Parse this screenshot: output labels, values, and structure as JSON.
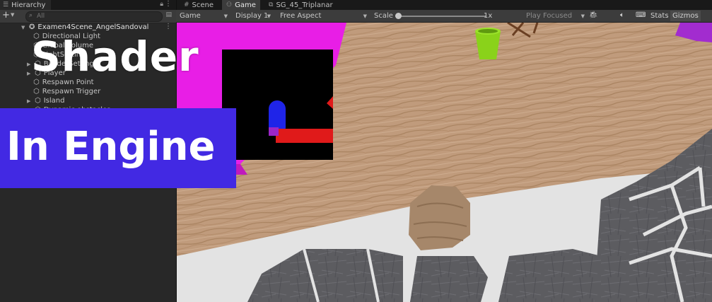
{
  "hierarchy": {
    "tab_label": "Hierarchy",
    "search_placeholder": "All",
    "add_label": "+",
    "items": [
      {
        "label": "Examen4Scene_AngelSandoval"
      },
      {
        "label": "Directional Light"
      },
      {
        "label": "Global Volume"
      },
      {
        "label": "LightSetting"
      },
      {
        "label": "BuilderSetting"
      },
      {
        "label": "Player"
      },
      {
        "label": "Respawn Point"
      },
      {
        "label": "Respawn Trigger"
      },
      {
        "label": "Island"
      },
      {
        "label": "Dynamic obstacles"
      }
    ]
  },
  "view": {
    "tabs": [
      {
        "label": "Scene",
        "icon": "grid-icon"
      },
      {
        "label": "Game",
        "icon": "gamepad-icon"
      },
      {
        "label": "SG_45_Triplanar",
        "icon": "shader-graph-icon"
      }
    ],
    "toolbar": {
      "display_mode": "Game",
      "display": "Display 1",
      "aspect": "Free Aspect",
      "scale_label": "Scale",
      "scale_value": "1x",
      "play_mode": "Play Focused",
      "stats_label": "Stats",
      "gizmos_label": "Gizmos"
    }
  },
  "overlay": {
    "title_top": "Shader",
    "title_bottom": "In Engine",
    "box_color": "#4229e3"
  },
  "colors": {
    "magenta_plane": "#e81ee6",
    "bucket": "#8ad21a",
    "white_border": "#e3e3e3"
  }
}
